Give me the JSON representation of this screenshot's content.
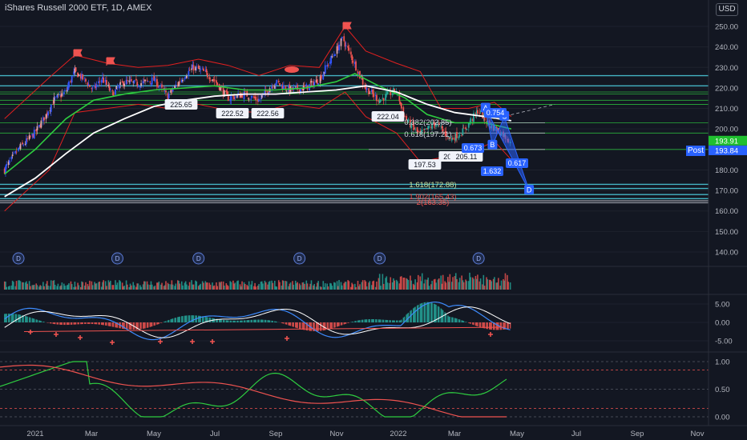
{
  "header": {
    "symbol_line": "iShares Russell 2000 ETF, 1D, AMEX",
    "currency": "USD",
    "session": "Post"
  },
  "colors": {
    "background": "#131722",
    "up": "#26a69a",
    "down": "#ef5350",
    "band": "#e02020",
    "ma_fast": "#2ecc40",
    "ma_slow": "#ffffff",
    "cyan": "#4dd0e1",
    "pattern": "#2962ff",
    "last_price_green": "#20c030",
    "post_blue": "#2962ff"
  },
  "chart_data": [
    {
      "type": "line",
      "panel": "price",
      "x_ticks": [
        "2021",
        "Mar",
        "May",
        "Jul",
        "Sep",
        "Nov",
        "2022",
        "Mar",
        "May",
        "Jul",
        "Sep",
        "Nov"
      ],
      "y_ticks": [
        "250.00",
        "240.00",
        "230.00",
        "220.00",
        "210.00",
        "200.00",
        "190.00",
        "180.00",
        "170.00",
        "160.00",
        "150.00",
        "140.00"
      ],
      "ylim": [
        130,
        256
      ],
      "last_price": "193.91",
      "post_price": "193.84",
      "series": [
        {
          "values": [
            [
              "2020-12-01",
              180
            ],
            [
              "2020-12-15",
              190
            ],
            [
              "2021-01-01",
              198
            ],
            [
              "2021-01-10",
              205
            ],
            [
              "2021-01-20",
              214
            ],
            [
              "2021-02-01",
              218
            ],
            [
              "2021-02-10",
              228
            ],
            [
              "2021-02-20",
              224
            ],
            [
              "2021-03-01",
              219
            ],
            [
              "2021-03-10",
              225
            ],
            [
              "2021-03-20",
              217
            ],
            [
              "2021-04-01",
              223
            ],
            [
              "2021-04-15",
              222
            ],
            [
              "2021-05-01",
              224
            ],
            [
              "2021-05-15",
              216
            ],
            [
              "2021-06-01",
              226
            ],
            [
              "2021-06-10",
              230
            ],
            [
              "2021-06-20",
              228
            ],
            [
              "2021-07-01",
              224
            ],
            [
              "2021-07-15",
              215
            ],
            [
              "2021-08-01",
              217
            ],
            [
              "2021-08-15",
              214
            ],
            [
              "2021-09-01",
              223
            ],
            [
              "2021-09-15",
              219
            ],
            [
              "2021-10-01",
              220
            ],
            [
              "2021-10-15",
              224
            ],
            [
              "2021-11-01",
              238
            ],
            [
              "2021-11-08",
              244
            ],
            [
              "2021-11-20",
              232
            ],
            [
              "2021-12-01",
              220
            ],
            [
              "2021-12-15",
              214
            ],
            [
              "2022-01-01",
              219
            ],
            [
              "2022-01-10",
              205
            ],
            [
              "2022-01-25",
              197
            ],
            [
              "2022-02-10",
              203
            ],
            [
              "2022-02-25",
              195
            ],
            [
              "2022-03-10",
              199
            ],
            [
              "2022-03-25",
              209
            ],
            [
              "2022-04-05",
              202
            ],
            [
              "2022-04-15",
              199
            ],
            [
              "2022-04-27",
              193.91
            ]
          ]
        },
        {
          "values": [
            [
              "2020-12-01",
              205
            ],
            [
              "2021-01-15",
              225
            ],
            [
              "2021-02-10",
              236
            ],
            [
              "2021-03-15",
              232
            ],
            [
              "2021-04-15",
              230
            ],
            [
              "2021-05-15",
              231
            ],
            [
              "2021-06-15",
              234
            ],
            [
              "2021-07-15",
              231
            ],
            [
              "2021-08-15",
              226
            ],
            [
              "2021-09-15",
              231
            ],
            [
              "2021-10-15",
              230
            ],
            [
              "2021-11-10",
              250
            ],
            [
              "2021-12-01",
              238
            ],
            [
              "2022-01-01",
              232
            ],
            [
              "2022-01-25",
              228
            ],
            [
              "2022-02-15",
              210
            ],
            [
              "2022-03-15",
              210
            ],
            [
              "2022-04-10",
              213
            ],
            [
              "2022-04-27",
              206
            ]
          ]
        },
        {
          "values": [
            [
              "2020-12-01",
              160
            ],
            [
              "2021-01-15",
              180
            ],
            [
              "2021-02-10",
              208
            ],
            [
              "2021-03-15",
              210
            ],
            [
              "2021-04-15",
              212
            ],
            [
              "2021-05-15",
              210
            ],
            [
              "2021-06-15",
              212
            ],
            [
              "2021-07-15",
              209
            ],
            [
              "2021-08-15",
              208
            ],
            [
              "2021-09-15",
              212
            ],
            [
              "2021-10-15",
              210
            ],
            [
              "2021-11-10",
              218
            ],
            [
              "2021-12-01",
              206
            ],
            [
              "2022-01-01",
              198
            ],
            [
              "2022-01-25",
              184
            ],
            [
              "2022-02-15",
              186
            ],
            [
              "2022-03-15",
              188
            ],
            [
              "2022-04-10",
              194
            ],
            [
              "2022-04-27",
              185
            ]
          ]
        },
        {
          "values": [
            [
              "2020-12-01",
              178
            ],
            [
              "2021-01-01",
              190
            ],
            [
              "2021-02-01",
              205
            ],
            [
              "2021-03-01",
              214
            ],
            [
              "2021-04-01",
              217
            ],
            [
              "2021-05-01",
              219
            ],
            [
              "2021-06-01",
              220
            ],
            [
              "2021-07-01",
              221
            ],
            [
              "2021-08-01",
              219
            ],
            [
              "2021-09-01",
              219
            ],
            [
              "2021-10-01",
              220
            ],
            [
              "2021-11-01",
              223
            ],
            [
              "2021-11-20",
              227
            ],
            [
              "2021-12-10",
              222
            ],
            [
              "2022-01-10",
              215
            ],
            [
              "2022-02-01",
              207
            ],
            [
              "2022-03-01",
              203
            ],
            [
              "2022-04-01",
              203
            ],
            [
              "2022-04-27",
              200
            ]
          ]
        },
        {
          "values": [
            [
              "2020-12-01",
              167
            ],
            [
              "2021-01-01",
              176
            ],
            [
              "2021-02-01",
              188
            ],
            [
              "2021-03-01",
              198
            ],
            [
              "2021-04-01",
              205
            ],
            [
              "2021-05-01",
              211
            ],
            [
              "2021-06-01",
              214
            ],
            [
              "2021-07-01",
              216
            ],
            [
              "2021-08-01",
              217
            ],
            [
              "2021-09-01",
              217
            ],
            [
              "2021-10-01",
              218
            ],
            [
              "2021-11-01",
              219
            ],
            [
              "2021-12-01",
              221
            ],
            [
              "2022-01-01",
              218
            ],
            [
              "2022-02-01",
              212
            ],
            [
              "2022-03-01",
              208
            ],
            [
              "2022-04-01",
              206
            ],
            [
              "2022-04-27",
              204
            ]
          ]
        }
      ],
      "horizontal_lines": [
        226,
        221,
        218,
        217,
        214,
        212,
        203,
        198,
        190,
        173,
        171,
        168,
        166,
        165,
        164
      ],
      "pattern_points": [
        {
          "label": "A",
          "x": "2022-04-01",
          "y": 210
        },
        {
          "label": "B",
          "x": "2022-04-08",
          "y": 192
        },
        {
          "label": "C",
          "x": "2022-04-20",
          "y": 206
        },
        {
          "label": "D",
          "x": "2022-05-15",
          "y": 170
        }
      ],
      "price_labels": [
        "225.65",
        "222.52",
        "222.56",
        "222.04",
        "197.53",
        "203.",
        "205.11"
      ],
      "fib_labels": [
        "0.382(202.85)",
        "0.618(197.21)",
        "1.618(172.88)",
        "1.902(165.43)",
        "2(163.35)"
      ],
      "ratio_labels": [
        "0.673",
        "0.754",
        "1.632",
        "0.617"
      ],
      "dividend_marker": "D",
      "dividend_dates": [
        "2020-12-15",
        "2021-03-25",
        "2021-06-15",
        "2021-09-25",
        "2021-12-15",
        "2022-03-25"
      ]
    },
    {
      "type": "bar",
      "panel": "volume",
      "series_note": ""
    },
    {
      "type": "line",
      "panel": "macd",
      "y_ticks": [
        "5.00",
        "0.00",
        "-5.00"
      ],
      "ylim": [
        -9,
        9
      ]
    },
    {
      "type": "line",
      "panel": "oscillator",
      "y_ticks": [
        "1.00",
        "0.50",
        "0.00"
      ],
      "ylim": [
        -0.05,
        1.05
      ]
    }
  ]
}
